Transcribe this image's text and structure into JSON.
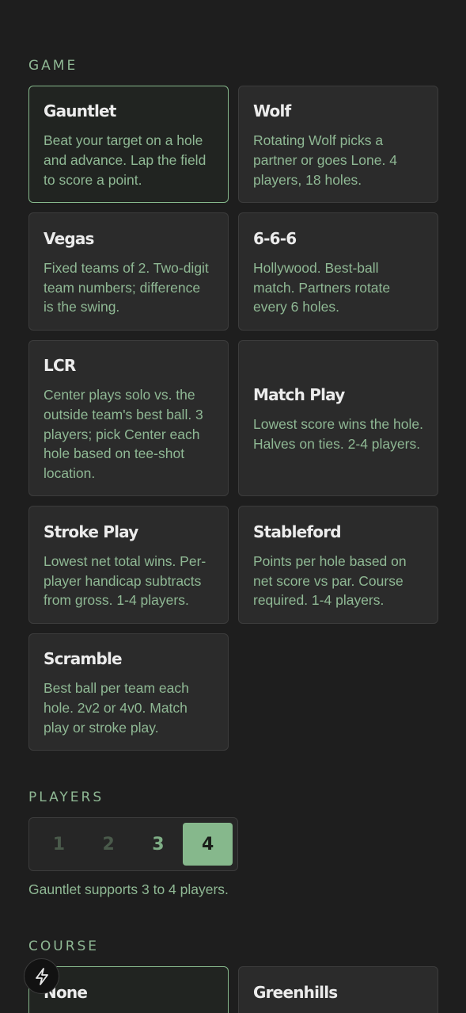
{
  "sections": {
    "game_label": "GAME",
    "players_label": "PLAYERS",
    "course_label": "COURSE"
  },
  "games": [
    {
      "title": "Gauntlet",
      "desc": "Beat your target on a hole and advance. Lap the field to score a point.",
      "selected": true
    },
    {
      "title": "Wolf",
      "desc": "Rotating Wolf picks a partner or goes Lone. 4 players, 18 holes.",
      "selected": false
    },
    {
      "title": "Vegas",
      "desc": "Fixed teams of 2. Two-digit team numbers; difference is the swing.",
      "selected": false
    },
    {
      "title": "6-6-6",
      "desc": "Hollywood. Best-ball match. Partners rotate every 6 holes.",
      "selected": false
    },
    {
      "title": "LCR",
      "desc": "Center plays solo vs. the outside team's best ball. 3 players; pick Center each hole based on tee-shot location.",
      "selected": false
    },
    {
      "title": "Match Play",
      "desc": "Lowest score wins the hole. Halves on ties. 2-4 players.",
      "selected": false
    },
    {
      "title": "Stroke Play",
      "desc": "Lowest net total wins. Per-player handicap subtracts from gross. 1-4 players.",
      "selected": false
    },
    {
      "title": "Stableford",
      "desc": "Points per hole based on net score vs par. Course required. 1-4 players.",
      "selected": false
    },
    {
      "title": "Scramble",
      "desc": "Best ball per team each hole. 2v2 or 4v0. Match play or stroke play.",
      "selected": false
    }
  ],
  "players": {
    "options": [
      "1",
      "2",
      "3",
      "4"
    ],
    "selected": "4",
    "note": "Gauntlet supports 3 to 4 players."
  },
  "courses": [
    {
      "title": "None",
      "selected": true
    },
    {
      "title": "Greenhills",
      "selected": false
    }
  ],
  "fab": {
    "icon": "lightning-icon"
  },
  "colors": {
    "background": "#1e1e1e",
    "card": "#2b2b2b",
    "accent": "#86b88c",
    "text_muted": "#8fb894",
    "title": "#ececec"
  }
}
